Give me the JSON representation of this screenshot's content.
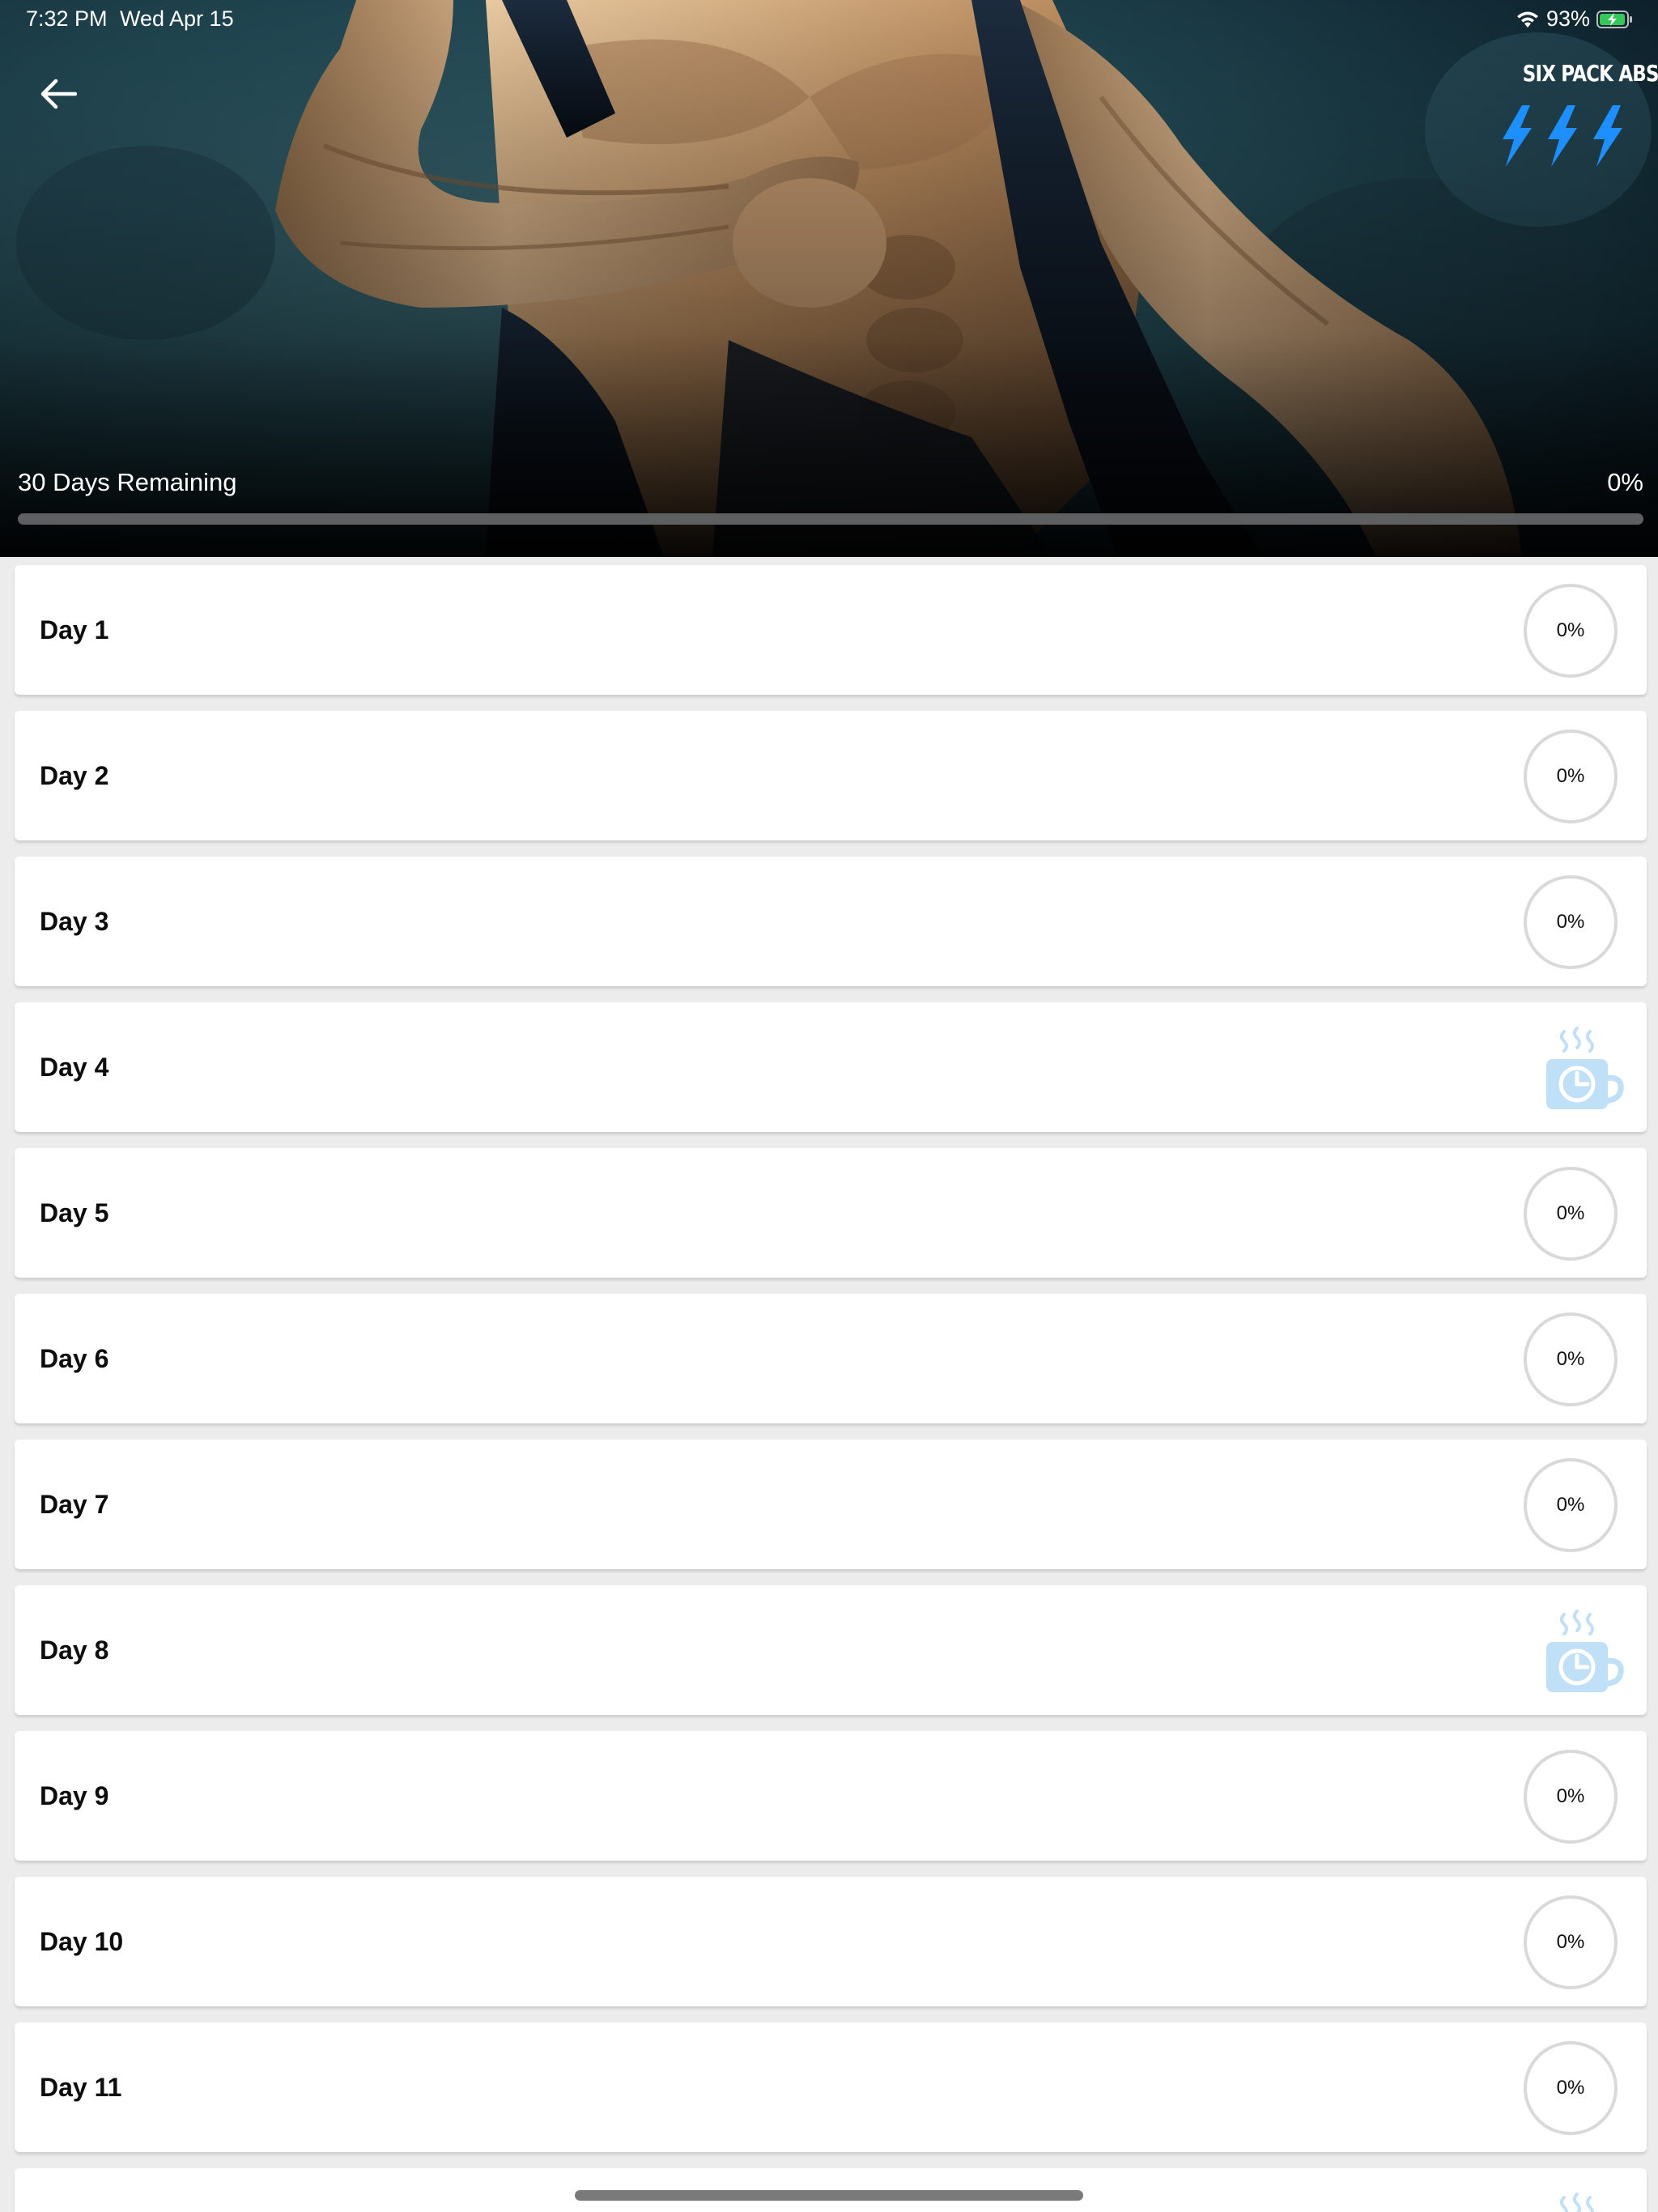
{
  "status_bar": {
    "time": "7:32 PM",
    "date": "Wed Apr 15",
    "battery_percent": "93%",
    "icons": [
      "wifi-icon",
      "battery-charging-icon"
    ]
  },
  "header": {
    "back_icon": "back-arrow-icon",
    "brand_title": "SIX PACK ABS",
    "brand_icon": "lightning-bolts-icon",
    "hero_image": "muscular-man-tearing-tank-top-photo"
  },
  "plan": {
    "remaining_label": "30 Days Remaining",
    "overall_percent_label": "0%",
    "overall_progress": 0
  },
  "days": [
    {
      "label": "Day 1",
      "type": "workout",
      "percent": "0%"
    },
    {
      "label": "Day 2",
      "type": "workout",
      "percent": "0%"
    },
    {
      "label": "Day 3",
      "type": "workout",
      "percent": "0%"
    },
    {
      "label": "Day 4",
      "type": "rest",
      "icon": "rest-coffee-cup-icon"
    },
    {
      "label": "Day 5",
      "type": "workout",
      "percent": "0%"
    },
    {
      "label": "Day 6",
      "type": "workout",
      "percent": "0%"
    },
    {
      "label": "Day 7",
      "type": "workout",
      "percent": "0%"
    },
    {
      "label": "Day 8",
      "type": "rest",
      "icon": "rest-coffee-cup-icon"
    },
    {
      "label": "Day 9",
      "type": "workout",
      "percent": "0%"
    },
    {
      "label": "Day 10",
      "type": "workout",
      "percent": "0%"
    },
    {
      "label": "Day 11",
      "type": "workout",
      "percent": "0%"
    },
    {
      "label": "",
      "type": "rest",
      "icon": "rest-coffee-cup-icon"
    }
  ],
  "colors": {
    "accent_blue": "#2a93ff",
    "rest_icon": "#bfe0f6",
    "progress_ring": "#d9d9d9",
    "list_background": "#ececec",
    "card_background": "#ffffff"
  }
}
